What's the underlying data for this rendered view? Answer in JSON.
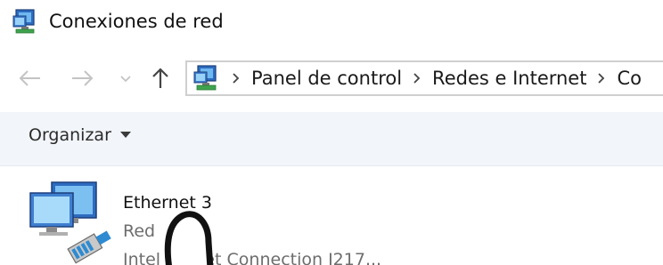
{
  "window": {
    "title": "Conexiones de red",
    "icon": "network-connections-icon"
  },
  "navigation": {
    "back_icon": "arrow-left-icon",
    "forward_icon": "arrow-right-icon",
    "recent_icon": "chevron-down-icon",
    "up_icon": "arrow-up-icon",
    "breadcrumb": [
      {
        "label": "Panel de control"
      },
      {
        "label": "Redes e Internet"
      },
      {
        "label": "Co"
      }
    ]
  },
  "commandbar": {
    "organize_label": "Organizar"
  },
  "connections": [
    {
      "name": "Ethernet 3",
      "status": "Red ",
      "adapter": "Intel  hernet Connection I217..."
    }
  ],
  "colors": {
    "commandbar_bg": "#f2f5f9",
    "address_border": "#cfcfcf",
    "secondary_text": "#6d6d6d"
  }
}
